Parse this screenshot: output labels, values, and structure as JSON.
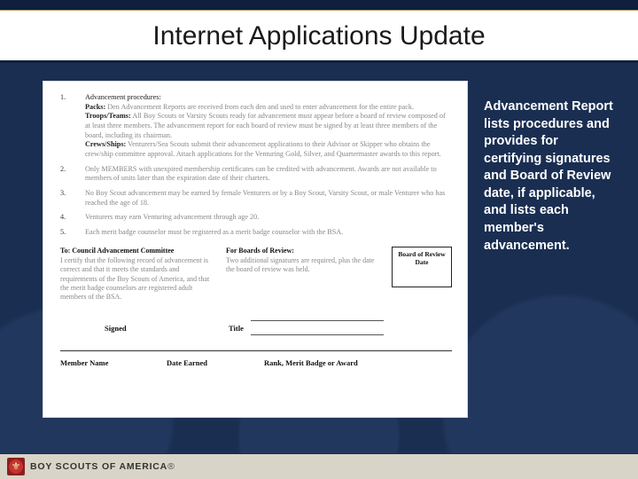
{
  "title": "Internet Applications Update",
  "doc": {
    "items": [
      {
        "num": "1.",
        "head": "Advancement procedures:",
        "packs_label": "Packs:",
        "packs_text": "Den Advancement Reports are received from each den and used to enter advancement for the entire pack.",
        "troops_label": "Troops/Teams:",
        "troops_text": "All Boy Scouts or Varsity Scouts ready for advancement must appear before a board of review composed of at least three members. The advancement report for each board of review must be signed by at least three members of the board, including its chairman.",
        "crews_label": "Crews/Ships:",
        "crews_text": "Venturers/Sea Scouts submit their advancement applications to their Advisor or Skipper who obtains the crew/ship committee approval. Attach applications for the Venturing Gold, Silver, and Quartermaster awards to this report."
      },
      {
        "num": "2.",
        "text": "Only MEMBERS with unexpired membership certificates can be credited with advancement. Awards are not available to members of units later than the expiration date of their charters."
      },
      {
        "num": "3.",
        "text": "No Boy Scout advancement may be earned by female Venturers or by a Boy Scout, Varsity Scout, or male Venturer who has reached the age of 18."
      },
      {
        "num": "4.",
        "text": "Venturers may earn Venturing advancement through age 20."
      },
      {
        "num": "5.",
        "text": "Each merit badge counselor must be registered as a merit badge counselor with the BSA."
      }
    ],
    "to_label": "To: Council Advancement Committee",
    "to_text": "I certify that the following record of advancement is correct and that it meets the standards and requirements of the Boy Scouts of America, and that the merit badge counselors are registered adult members of the BSA.",
    "for_label": "For Boards of Review:",
    "for_text": "Two additional signatures are required, plus the date the board of review was held.",
    "bor_box": "Board of Review Date",
    "signed": "Signed",
    "titleLbl": "Title",
    "cols": {
      "c1": "Member Name",
      "c2": "Date Earned",
      "c3": "Rank, Merit Badge or Award"
    }
  },
  "sidebar": "Advancement Report  lists procedures and provides for certifying signatures and Board of Review date, if applicable, and lists each member's advancement.",
  "footer_brand": "BOY SCOUTS OF AMERICA"
}
